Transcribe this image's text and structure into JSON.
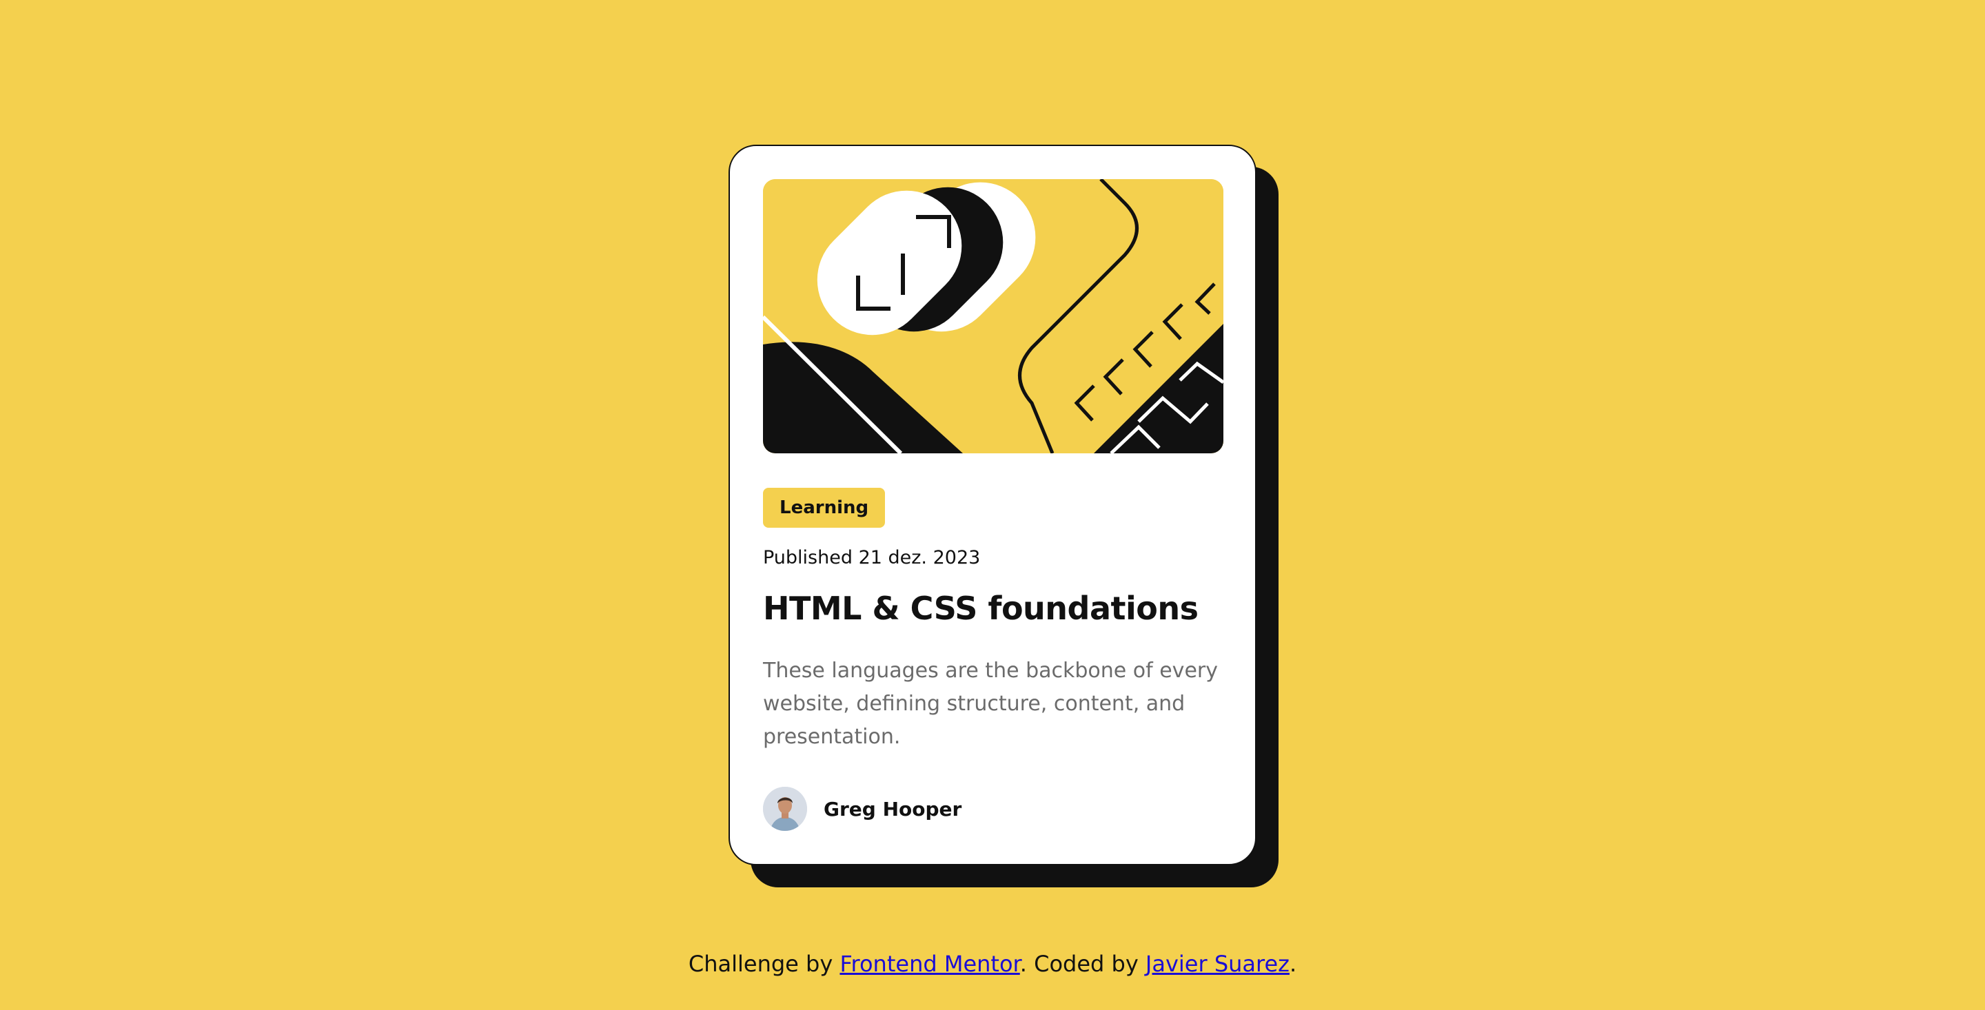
{
  "card": {
    "category": "Learning",
    "published": "Published 21 dez. 2023",
    "title": "HTML & CSS foundations",
    "description": "These languages are the backbone of every website, defining structure, content, and presentation.",
    "author": "Greg Hooper"
  },
  "attribution": {
    "prefix": "Challenge by ",
    "link1": "Frontend Mentor",
    "middle": ". Coded by ",
    "link2": "Javier Suarez",
    "suffix": "."
  },
  "colors": {
    "background": "#f4d04e",
    "card": "#ffffff",
    "ink": "#111111",
    "muted": "#6b6b6b",
    "link": "#1a0dd6"
  },
  "icons": [
    "illustration-article",
    "author-avatar"
  ]
}
